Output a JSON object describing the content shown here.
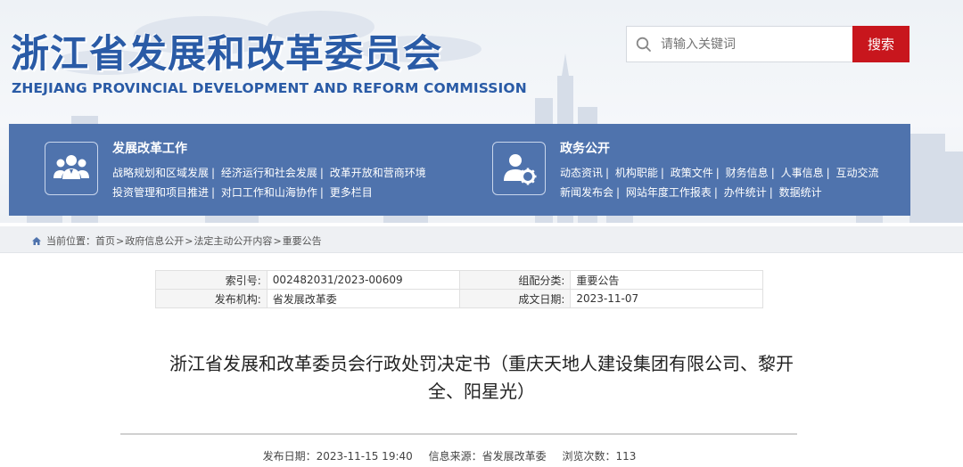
{
  "header": {
    "logo_cn": "浙江省发展和改革委员会",
    "logo_en": "ZHEJIANG PROVINCIAL DEVELOPMENT AND REFORM COMMISSION",
    "search_placeholder": "请输入关键词",
    "search_button": "搜索"
  },
  "nav": {
    "left": {
      "title": "发展改革工作",
      "rows": [
        [
          "战略规划和区域发展",
          "经济运行和社会发展",
          "改革开放和营商环境"
        ],
        [
          "投资管理和项目推进",
          "对口工作和山海协作",
          "更多栏目"
        ]
      ]
    },
    "right": {
      "title": "政务公开",
      "rows": [
        [
          "动态资讯",
          "机构职能",
          "政策文件",
          "财务信息",
          "人事信息",
          "互动交流"
        ],
        [
          "新闻发布会",
          "网站年度工作报表",
          "办件统计",
          "数据统计"
        ]
      ]
    }
  },
  "breadcrumb": {
    "prefix": "当前位置：",
    "items": [
      "首页",
      "政府信息公开",
      "法定主动公开内容",
      "重要公告"
    ]
  },
  "info": {
    "index_label": "索引号:",
    "index_value": "002482031/2023-00609",
    "category_label": "组配分类:",
    "category_value": "重要公告",
    "publisher_label": "发布机构:",
    "publisher_value": "省发展改革委",
    "date_label": "成文日期:",
    "date_value": "2023-11-07"
  },
  "doc": {
    "title_line1": "浙江省发展和改革委员会行政处罚决定书（重庆天地人建设集团有限公司、黎开",
    "title_line2": "全、阳星光）",
    "publish_label": "发布日期：",
    "publish_value": "2023-11-15 19:40",
    "source_label": "信息来源：",
    "source_value": "省发展改革委",
    "views_label": "浏览次数：",
    "views_value": "113"
  },
  "colors": {
    "brand_blue": "#2a5ba6",
    "nav_blue": "#4f73ad",
    "search_red": "#c8161d"
  }
}
